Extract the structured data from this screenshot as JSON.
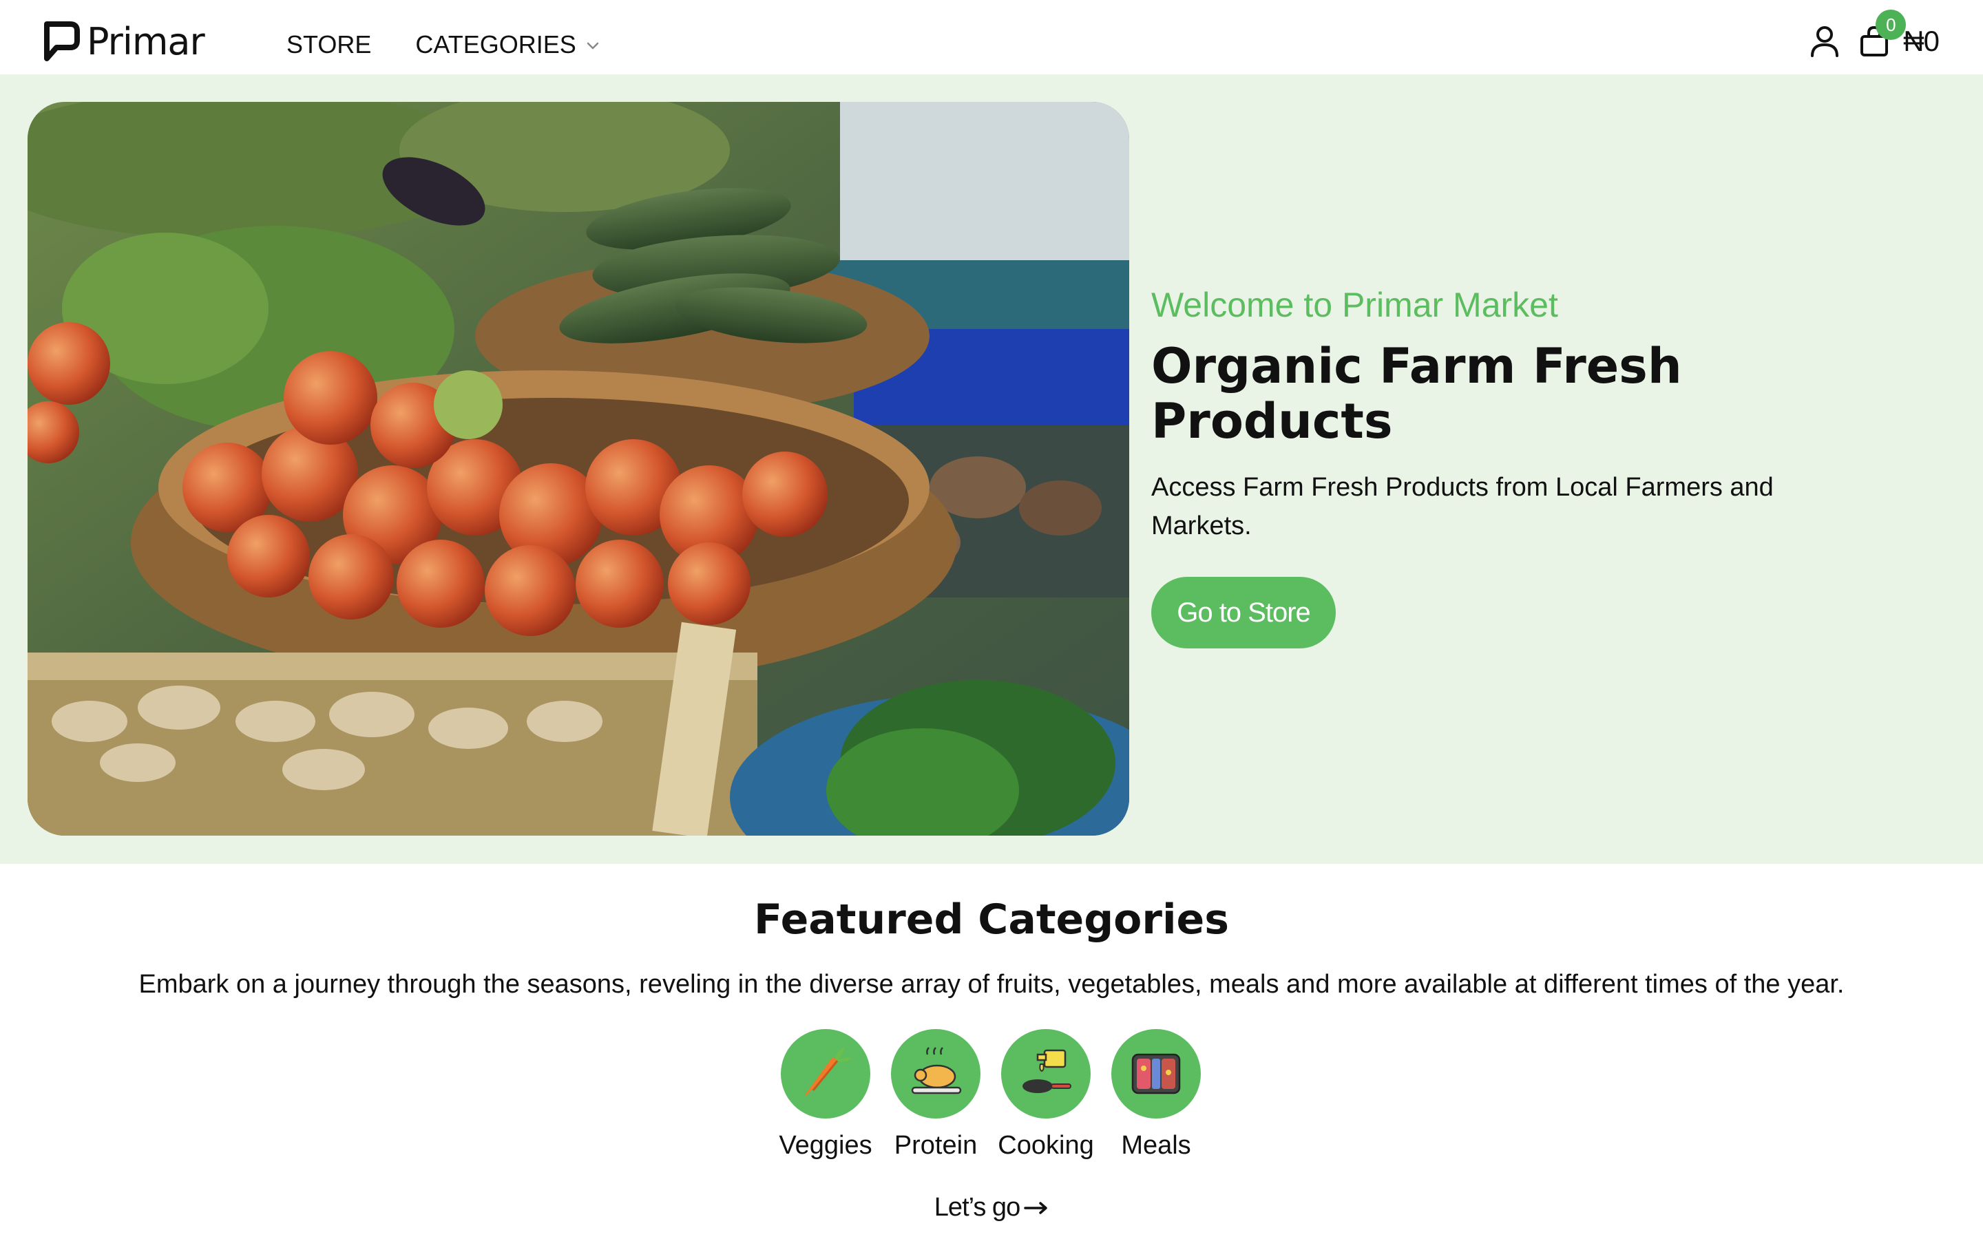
{
  "brand": {
    "name": "Primar"
  },
  "nav": {
    "store": "STORE",
    "categories": "CATEGORIES"
  },
  "header": {
    "cart_count": "0",
    "cart_total": "₦0"
  },
  "hero": {
    "welcome": "Welcome to Primar Market",
    "title": "Organic Farm Fresh Products",
    "description": "Access Farm Fresh Products from Local Farmers and Markets.",
    "cta": "Go to Store"
  },
  "featured": {
    "title": "Featured Categories",
    "description": "Embark on a journey through the seasons, reveling in the diverse array of fruits, vegetables, meals and more available at different times of the year.",
    "categories": [
      {
        "label": "Veggies",
        "icon": "carrot-icon"
      },
      {
        "label": "Protein",
        "icon": "roast-chicken-icon"
      },
      {
        "label": "Cooking",
        "icon": "cooking-oil-pan-icon"
      },
      {
        "label": "Meals",
        "icon": "meal-box-icon"
      }
    ],
    "cta": "Let’s go"
  },
  "colors": {
    "accent": "#5bbd5f",
    "hero_bg": "#eaf4e6",
    "text": "#111111"
  }
}
